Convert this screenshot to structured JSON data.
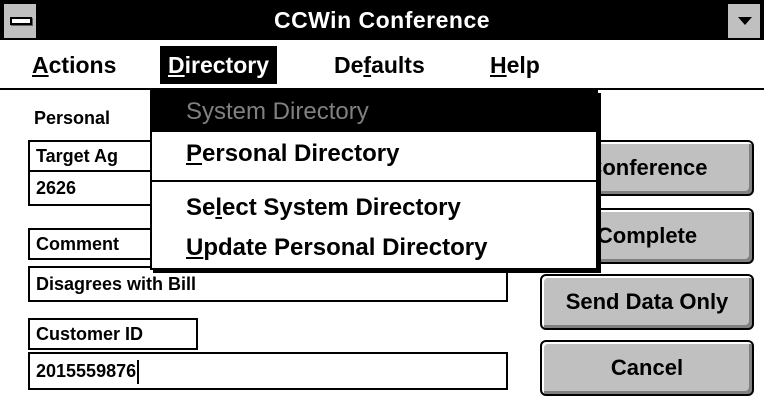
{
  "window": {
    "title": "CCWin Conference"
  },
  "menubar": {
    "actions": "Actions",
    "directory": "Directory",
    "defaults": "Defaults",
    "help": "Help"
  },
  "form": {
    "personal_label": "Personal",
    "target_label": "Target Ag",
    "target_value": "2626",
    "comment_label": "Comment",
    "comment_value": "Disagrees with Bill",
    "customer_label": "Customer ID",
    "customer_value": "2015559876"
  },
  "buttons": {
    "conference": "Conference",
    "complete": "Complete",
    "send_data": "Send Data Only",
    "cancel": "Cancel"
  },
  "directory_menu": {
    "items": [
      "System Directory",
      "Personal Directory",
      "Select System Directory",
      "Update Personal Directory"
    ]
  }
}
